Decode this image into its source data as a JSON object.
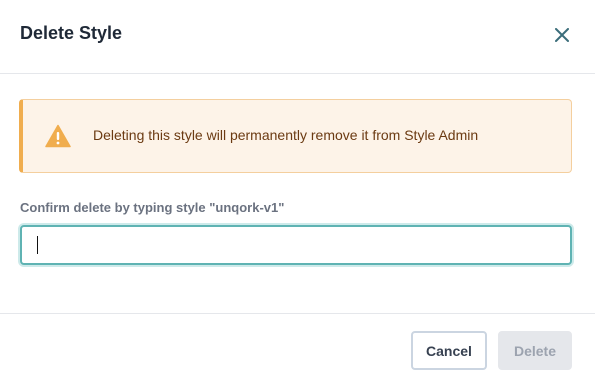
{
  "dialog": {
    "title": "Delete Style",
    "close_icon": "close-icon"
  },
  "alert": {
    "icon": "warning-icon",
    "message": "Deleting this style will permanently remove it from Style Admin",
    "colors": {
      "background": "#fdf3e8",
      "accent": "#f0ad4e",
      "text": "#6b3a12"
    }
  },
  "confirm_field": {
    "label": "Confirm delete by typing style \"unqork-v1\"",
    "value": "",
    "placeholder": ""
  },
  "footer": {
    "cancel_label": "Cancel",
    "delete_label": "Delete",
    "delete_disabled": true
  }
}
